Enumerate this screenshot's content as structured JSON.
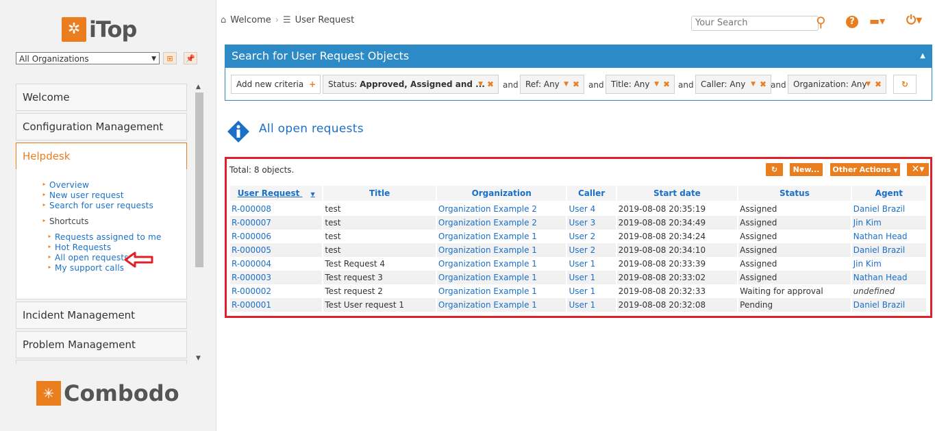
{
  "brand": {
    "app_name": "iTop",
    "vendor_name": "Combodo"
  },
  "left_panel": {
    "org_selector": {
      "value": "All Organizations"
    },
    "menus": [
      {
        "label": "Welcome"
      },
      {
        "label": "Configuration Management"
      },
      {
        "label": "Helpdesk"
      },
      {
        "label": "Incident Management"
      },
      {
        "label": "Problem Management"
      }
    ],
    "helpdesk": {
      "items": [
        "Overview",
        "New user request",
        "Search for user requests"
      ],
      "shortcuts_label": "Shortcuts",
      "shortcuts": [
        "Requests assigned to me",
        "Hot Requests",
        "All open requests",
        "My support calls"
      ]
    }
  },
  "header": {
    "breadcrumb": [
      "Welcome",
      "User Request"
    ],
    "search_placeholder": "Your Search"
  },
  "search_panel": {
    "title": "Search for User Request Objects",
    "add_criteria": "Add new criteria",
    "and": "and",
    "criteria": [
      {
        "label": "Status:",
        "value": "Approved, Assigned and ..."
      },
      {
        "label": "Ref:",
        "value": "Any"
      },
      {
        "label": "Title:",
        "value": "Any"
      },
      {
        "label": "Caller:",
        "value": "Any"
      },
      {
        "label": "Organization:",
        "value": "Any"
      }
    ]
  },
  "page_title": "All open requests",
  "results": {
    "total": "Total: 8 objects.",
    "buttons": {
      "new": "New...",
      "other_actions": "Other Actions"
    },
    "columns": [
      "User Request",
      "Title",
      "Organization",
      "Caller",
      "Start date",
      "Status",
      "Agent"
    ],
    "rows": [
      {
        "ref": "R-000008",
        "title": "test",
        "org": "Organization Example 2",
        "caller": "User 4",
        "start": "2019-08-08 20:35:19",
        "status": "Assigned",
        "agent": "Daniel Brazil"
      },
      {
        "ref": "R-000007",
        "title": "test",
        "org": "Organization Example 2",
        "caller": "User 3",
        "start": "2019-08-08 20:34:49",
        "status": "Assigned",
        "agent": "Jin Kim"
      },
      {
        "ref": "R-000006",
        "title": "test",
        "org": "Organization Example 1",
        "caller": "User 2",
        "start": "2019-08-08 20:34:24",
        "status": "Assigned",
        "agent": "Nathan Head"
      },
      {
        "ref": "R-000005",
        "title": "test",
        "org": "Organization Example 1",
        "caller": "User 2",
        "start": "2019-08-08 20:34:10",
        "status": "Assigned",
        "agent": "Daniel Brazil"
      },
      {
        "ref": "R-000004",
        "title": "Test Request 4",
        "org": "Organization Example 1",
        "caller": "User 1",
        "start": "2019-08-08 20:33:39",
        "status": "Assigned",
        "agent": "Jin Kim"
      },
      {
        "ref": "R-000003",
        "title": "Test request 3",
        "org": "Organization Example 1",
        "caller": "User 1",
        "start": "2019-08-08 20:33:02",
        "status": "Assigned",
        "agent": "Nathan Head"
      },
      {
        "ref": "R-000002",
        "title": "Test request 2",
        "org": "Organization Example 1",
        "caller": "User 1",
        "start": "2019-08-08 20:32:33",
        "status": "Waiting for approval",
        "agent": "undefined"
      },
      {
        "ref": "R-000001",
        "title": "Test User request 1",
        "org": "Organization Example 1",
        "caller": "User 1",
        "start": "2019-08-08 20:32:08",
        "status": "Pending",
        "agent": "Daniel Brazil"
      }
    ]
  },
  "colors": {
    "accent": "#ea7d1e",
    "link": "#1a70c8",
    "panel_header": "#2c8ac6",
    "highlight_border": "#e02029"
  }
}
